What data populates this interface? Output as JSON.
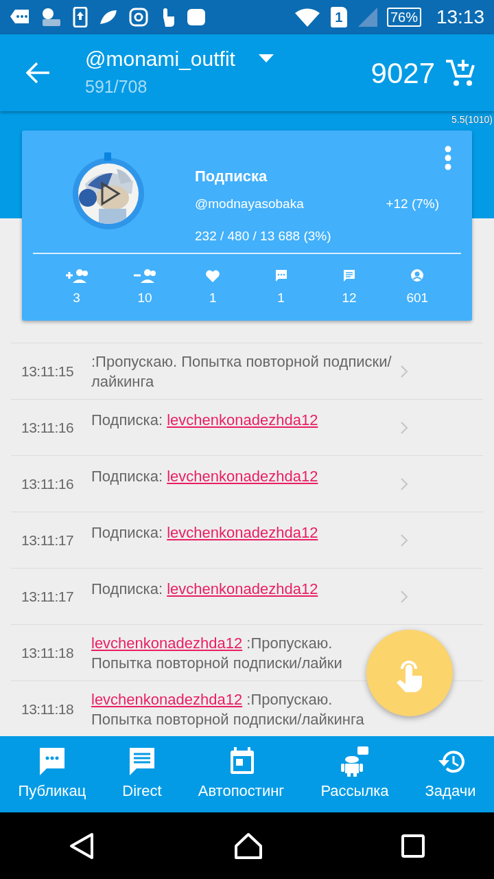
{
  "status_bar": {
    "battery": "76%",
    "sim": "1",
    "time": "13:13"
  },
  "app_bar": {
    "account": "@monami_outfit",
    "progress": "591/708",
    "balance": "9027"
  },
  "version": "5.5(1010)",
  "task_card": {
    "title": "Подписка",
    "target": "@modnayasobaka",
    "gain": "+12 (7%)",
    "counts": "232 / 480 / 13 688 (3%)",
    "stats": [
      {
        "kind": "follow",
        "value": "3"
      },
      {
        "kind": "unfollow",
        "value": "10"
      },
      {
        "kind": "like",
        "value": "1"
      },
      {
        "kind": "comment",
        "value": "1"
      },
      {
        "kind": "message",
        "value": "12"
      },
      {
        "kind": "profile",
        "value": "601"
      }
    ]
  },
  "log": [
    {
      "time": "13:11:15",
      "kind": "message",
      "text": ":Пропускаю. Попытка повторной подписки/лайкинга"
    },
    {
      "time": "13:11:16",
      "kind": "subscribe",
      "label": "Подписка:",
      "user": "levchenkonadezhda12"
    },
    {
      "time": "13:11:16",
      "kind": "subscribe",
      "label": "Подписка:",
      "user": "levchenkonadezhda12"
    },
    {
      "time": "13:11:17",
      "kind": "subscribe",
      "label": "Подписка:",
      "user": "levchenkonadezhda12"
    },
    {
      "time": "13:11:17",
      "kind": "subscribe",
      "label": "Подписка:",
      "user": "levchenkonadezhda12"
    },
    {
      "time": "13:11:18",
      "kind": "skip",
      "user": "levchenkonadezhda12",
      "note": ":Пропускаю.",
      "text": "Попытка повторной подписки/лайки"
    },
    {
      "time": "13:11:18",
      "kind": "skip",
      "user": "levchenkonadezhda12",
      "note": ":Пропускаю.",
      "text": "Попытка повторной подписки/лайкинга"
    }
  ],
  "bottom_nav": [
    {
      "kind": "posts",
      "label": "Публикац"
    },
    {
      "kind": "direct",
      "label": "Direct"
    },
    {
      "kind": "autopost",
      "label": "Автопостинг"
    },
    {
      "kind": "mailing",
      "label": "Рассылка"
    },
    {
      "kind": "tasks",
      "label": "Задачи"
    }
  ]
}
